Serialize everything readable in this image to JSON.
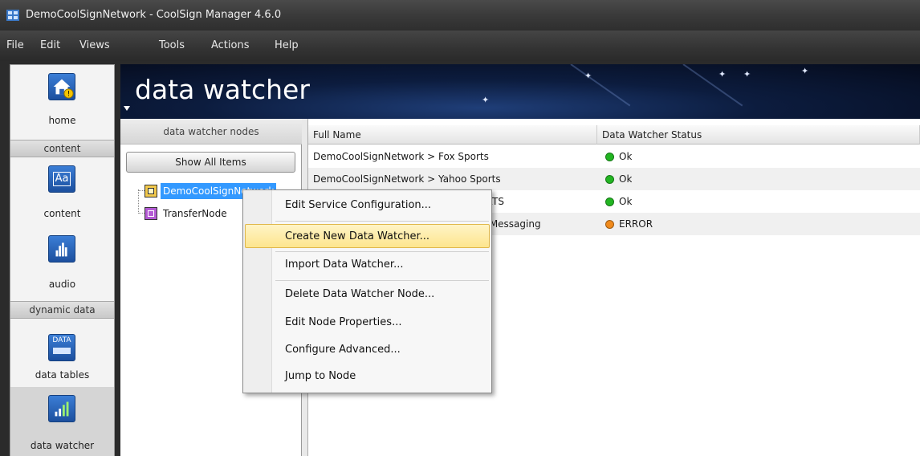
{
  "window": {
    "title": "DemoCoolSignNetwork - CoolSign Manager 4.6.0"
  },
  "menu": [
    {
      "label": "File"
    },
    {
      "label": "Edit"
    },
    {
      "label": "Views"
    },
    {
      "label": "Tools"
    },
    {
      "label": "Actions"
    },
    {
      "label": "Help"
    }
  ],
  "nav": {
    "home": "home",
    "section_content": "content",
    "content": "content",
    "audio": "audio",
    "section_dynamic": "dynamic data",
    "data_tables": "data tables",
    "data_watcher": "data watcher",
    "content_icon_text": "Aa",
    "data_icon_text": "DATA"
  },
  "banner": {
    "title": "data watcher"
  },
  "tree": {
    "header": "data watcher nodes",
    "show_all": "Show All Items",
    "nodes": [
      {
        "label": "DemoCoolSignNetwork",
        "selected": true,
        "icon": "database-node-icon"
      },
      {
        "label": "TransferNode",
        "selected": false,
        "icon": "transfer-node-icon"
      }
    ]
  },
  "grid": {
    "columns": [
      "Full Name",
      "Data Watcher Status"
    ],
    "rows": [
      {
        "name": "DemoCoolSignNetwork > Fox Sports",
        "status": "Ok",
        "status_color": "#22b522"
      },
      {
        "name": "DemoCoolSignNetwork > Yahoo Sports",
        "status": "Ok",
        "status_color": "#22b522"
      },
      {
        "name": "DemoCoolSignNetwork > ESPN SPORTS",
        "status": "Ok",
        "status_color": "#22b522"
      },
      {
        "name": "DemoCoolSignNetwork > Corporate Messaging",
        "status": "ERROR",
        "status_color": "#f08a1c"
      }
    ]
  },
  "context_menu": {
    "items": [
      {
        "label": "Edit Service Configuration...",
        "highlighted": false
      },
      {
        "label": "Create New Data Watcher...",
        "highlighted": true
      },
      {
        "label": "Import Data Watcher...",
        "highlighted": false
      },
      {
        "label": "Delete Data Watcher Node...",
        "highlighted": false
      },
      {
        "label": "Edit Node Properties...",
        "highlighted": false
      },
      {
        "label": "Configure Advanced...",
        "highlighted": false
      },
      {
        "label": "Jump to Node",
        "highlighted": false
      }
    ]
  },
  "colors": {
    "highlight": "#fde58e",
    "selection": "#3399ff",
    "status_ok": "#22b522",
    "status_error": "#f08a1c"
  }
}
